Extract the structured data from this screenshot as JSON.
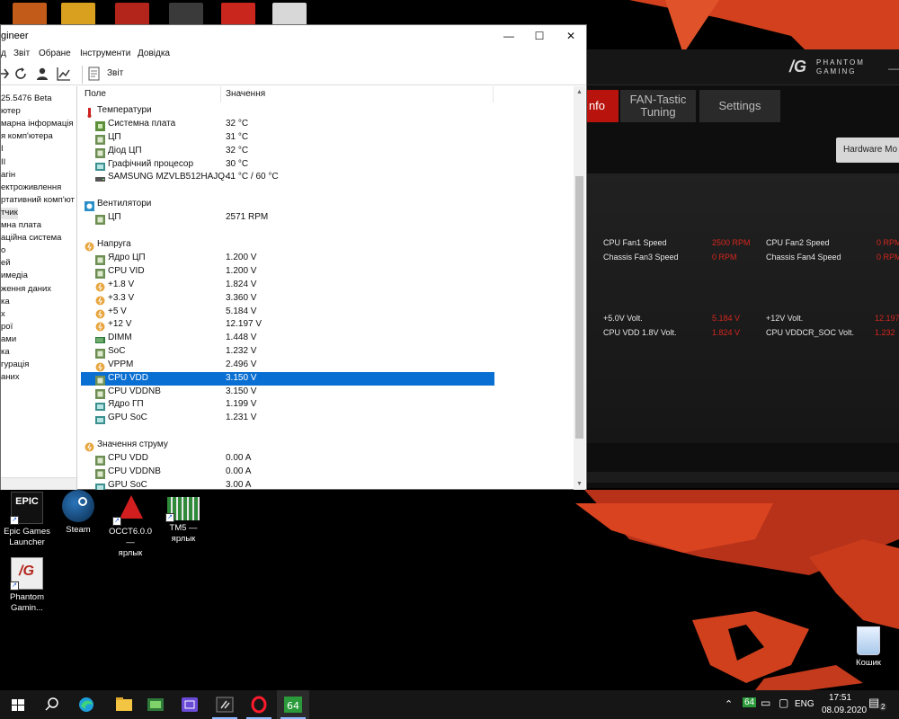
{
  "aida": {
    "title_partial": "gineer",
    "menu": [
      "д",
      "Звіт",
      "Обране",
      "Інструменти",
      "Довідка"
    ],
    "toolbar_report": "Звіт",
    "tree": [
      "25.5476 Beta",
      "ютер",
      "марна інформація",
      "я комп'ютера",
      "I",
      "II",
      "агін",
      "ектроживлення",
      "ртативний комп'ют",
      "тчик",
      "мна плата",
      "аційна система",
      "о",
      "ей",
      "имедіа",
      "ження даних",
      "ка",
      "х",
      "рої",
      "ами",
      "ка",
      "гурація",
      "аних"
    ],
    "tree_selected_index": 9,
    "columns": {
      "field": "Поле",
      "value": "Значення"
    },
    "groups": [
      {
        "title": "Температури",
        "icon": "thermometer-icon",
        "rows": [
          {
            "field": "Системна плата",
            "value": "32 °C",
            "icon": "motherboard-icon"
          },
          {
            "field": "ЦП",
            "value": "31 °C",
            "icon": "cpu-chip-icon"
          },
          {
            "field": "Діод ЦП",
            "value": "32 °C",
            "icon": "cpu-chip-icon"
          },
          {
            "field": "Графічний процесор",
            "value": "30 °C",
            "icon": "gpu-icon"
          },
          {
            "field": "SAMSUNG MZVLB512HAJQ-...",
            "value": "41 °C / 60 °C",
            "icon": "drive-icon"
          }
        ]
      },
      {
        "title": "Вентилятори",
        "icon": "fan-icon",
        "rows": [
          {
            "field": "ЦП",
            "value": "2571 RPM",
            "icon": "cpu-chip-icon"
          }
        ]
      },
      {
        "title": "Напруга",
        "icon": "voltage-icon",
        "rows": [
          {
            "field": "Ядро ЦП",
            "value": "1.200 V",
            "icon": "cpu-chip-icon"
          },
          {
            "field": "CPU VID",
            "value": "1.200 V",
            "icon": "cpu-chip-icon"
          },
          {
            "field": "+1.8 V",
            "value": "1.824 V",
            "icon": "voltage-icon"
          },
          {
            "field": "+3.3 V",
            "value": "3.360 V",
            "icon": "voltage-icon"
          },
          {
            "field": "+5 V",
            "value": "5.184 V",
            "icon": "voltage-icon"
          },
          {
            "field": "+12 V",
            "value": "12.197 V",
            "icon": "voltage-icon"
          },
          {
            "field": "DIMM",
            "value": "1.448 V",
            "icon": "memory-icon"
          },
          {
            "field": "SoC",
            "value": "1.232 V",
            "icon": "cpu-chip-icon"
          },
          {
            "field": "VPPM",
            "value": "2.496 V",
            "icon": "voltage-icon"
          },
          {
            "field": "CPU VDD",
            "value": "3.150 V",
            "icon": "cpu-chip-icon",
            "selected": true
          },
          {
            "field": "CPU VDDNB",
            "value": "3.150 V",
            "icon": "cpu-chip-icon"
          },
          {
            "field": "Ядро ГП",
            "value": "1.199 V",
            "icon": "gpu-icon"
          },
          {
            "field": "GPU SoC",
            "value": "1.231 V",
            "icon": "gpu-icon"
          }
        ]
      },
      {
        "title": "Значення струму",
        "icon": "current-icon",
        "rows": [
          {
            "field": "CPU VDD",
            "value": "0.00 A",
            "icon": "cpu-chip-icon"
          },
          {
            "field": "CPU VDDNB",
            "value": "0.00 A",
            "icon": "cpu-chip-icon"
          },
          {
            "field": "GPU SoC",
            "value": "3.00 A",
            "icon": "gpu-icon"
          }
        ]
      }
    ]
  },
  "phantom": {
    "logo_line1": "PHANTOM",
    "logo_line2": "GAMING",
    "tabs": [
      "nfo",
      "FAN-Tastic Tuning",
      "Settings"
    ],
    "hw_button": "Hardware Mo",
    "fans": [
      {
        "label": "CPU Fan1 Speed",
        "value": "2500 RPM"
      },
      {
        "label": "CPU Fan2 Speed",
        "value": "0 RPM"
      },
      {
        "label": "Chassis Fan3 Speed",
        "value": "0 RPM"
      },
      {
        "label": "Chassis Fan4 Speed",
        "value": "0 RPM"
      }
    ],
    "volts": [
      {
        "label": "+5.0V Volt.",
        "value": "5.184 V"
      },
      {
        "label": "+12V Volt.",
        "value": "12.197"
      },
      {
        "label": "CPU VDD 1.8V Volt.",
        "value": "1.824 V"
      },
      {
        "label": "CPU VDDCR_SOC Volt.",
        "value": "1.232"
      }
    ]
  },
  "desktop": {
    "shortcuts": [
      {
        "label": "Epic Games Launcher",
        "line1": "Epic Games",
        "line2": "Launcher",
        "tile_text": "EPIC"
      },
      {
        "label": "Steam",
        "line1": "Steam",
        "line2": "",
        "tile_text": ""
      },
      {
        "label": "OCCT6.0.0 — ярлык",
        "line1": "OCCT6.0.0 —",
        "line2": "ярлык",
        "tile_text": ""
      },
      {
        "label": "TM5 — ярлык",
        "line1": "TM5 —",
        "line2": "ярлык",
        "tile_text": ""
      },
      {
        "label": "Phantom Gamin...",
        "line1": "Phantom",
        "line2": "Gamin...",
        "tile_text": ""
      }
    ],
    "recycle_bin": "Кошик"
  },
  "taskbar": {
    "apps": [
      "start-icon",
      "search-icon",
      "edge-icon",
      "file-explorer-icon",
      "gpu-z-icon",
      "ryzen-master-icon",
      "phantom-gaming-icon",
      "opera-icon",
      "aida64-icon"
    ],
    "tray_badge": "64",
    "lang": "ENG",
    "time": "17:51",
    "date": "08.09.2020",
    "notifications": "2"
  }
}
